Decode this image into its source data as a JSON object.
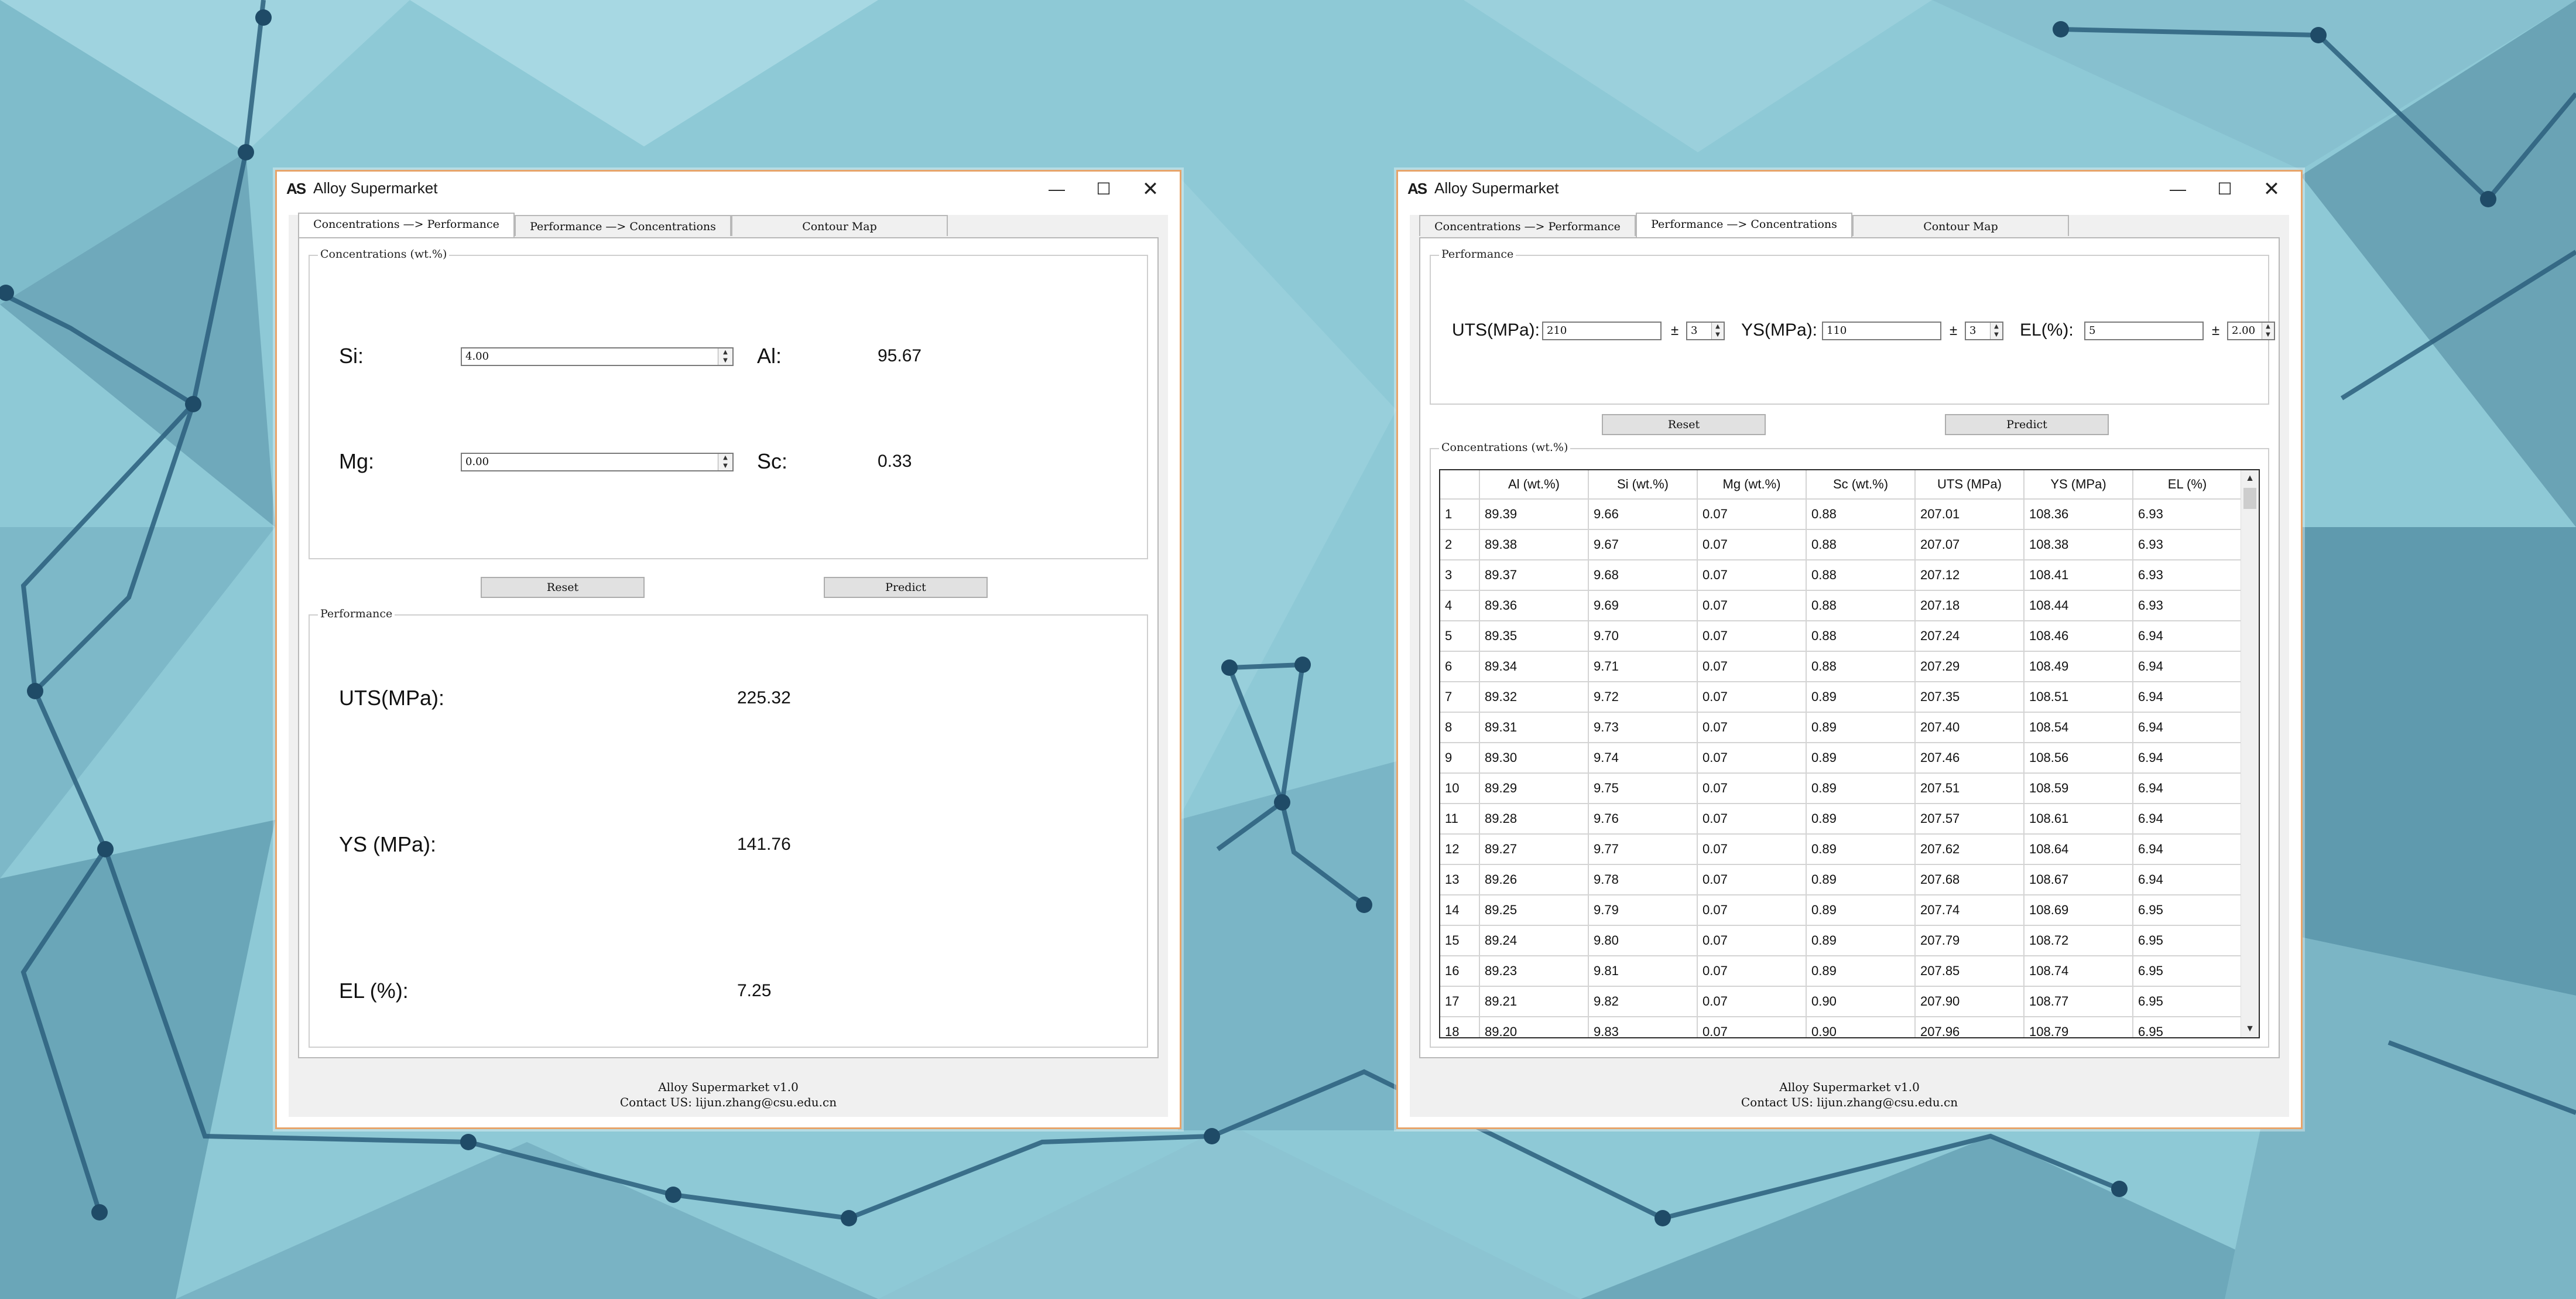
{
  "app": {
    "title": "Alloy Supermarket",
    "logo": "AS"
  },
  "window_controls": {
    "minimize": "—",
    "maximize": "☐",
    "close": "✕"
  },
  "tabs": [
    "Concentrations —> Performance",
    "Performance —> Concentrations",
    "Contour Map"
  ],
  "footer": {
    "line1": "Alloy Supermarket v1.0",
    "line2": "Contact US: lijun.zhang@csu.edu.cn"
  },
  "left_window": {
    "concentrations_group": "Concentrations (wt.%)",
    "si_label": "Si:",
    "si_value": "4.00",
    "al_label": "Al:",
    "al_value": "95.67",
    "mg_label": "Mg:",
    "mg_value": "0.00",
    "sc_label": "Sc:",
    "sc_value": "0.33",
    "reset": "Reset",
    "predict": "Predict",
    "performance_group": "Performance",
    "uts_label": "UTS(MPa):",
    "uts_value": "225.32",
    "ys_label": "YS (MPa):",
    "ys_value": "141.76",
    "el_label": "EL (%):",
    "el_value": "7.25"
  },
  "right_window": {
    "performance_group": "Performance",
    "uts_label": "UTS(MPa):",
    "uts_value": "210",
    "uts_tol": "3",
    "ys_label": "YS(MPa):",
    "ys_value": "110",
    "ys_tol": "3",
    "el_label": "EL(%):",
    "el_value": "5",
    "el_tol": "2.00",
    "pm": "±",
    "reset": "Reset",
    "predict": "Predict",
    "concentrations_group": "Concentrations (wt.%)",
    "columns": [
      "Al (wt.%)",
      "Si (wt.%)",
      "Mg (wt.%)",
      "Sc (wt.%)",
      "UTS (MPa)",
      "YS (MPa)",
      "EL (%)"
    ],
    "rows": [
      [
        "1",
        "89.39",
        "9.66",
        "0.07",
        "0.88",
        "207.01",
        "108.36",
        "6.93"
      ],
      [
        "2",
        "89.38",
        "9.67",
        "0.07",
        "0.88",
        "207.07",
        "108.38",
        "6.93"
      ],
      [
        "3",
        "89.37",
        "9.68",
        "0.07",
        "0.88",
        "207.12",
        "108.41",
        "6.93"
      ],
      [
        "4",
        "89.36",
        "9.69",
        "0.07",
        "0.88",
        "207.18",
        "108.44",
        "6.93"
      ],
      [
        "5",
        "89.35",
        "9.70",
        "0.07",
        "0.88",
        "207.24",
        "108.46",
        "6.94"
      ],
      [
        "6",
        "89.34",
        "9.71",
        "0.07",
        "0.88",
        "207.29",
        "108.49",
        "6.94"
      ],
      [
        "7",
        "89.32",
        "9.72",
        "0.07",
        "0.89",
        "207.35",
        "108.51",
        "6.94"
      ],
      [
        "8",
        "89.31",
        "9.73",
        "0.07",
        "0.89",
        "207.40",
        "108.54",
        "6.94"
      ],
      [
        "9",
        "89.30",
        "9.74",
        "0.07",
        "0.89",
        "207.46",
        "108.56",
        "6.94"
      ],
      [
        "10",
        "89.29",
        "9.75",
        "0.07",
        "0.89",
        "207.51",
        "108.59",
        "6.94"
      ],
      [
        "11",
        "89.28",
        "9.76",
        "0.07",
        "0.89",
        "207.57",
        "108.61",
        "6.94"
      ],
      [
        "12",
        "89.27",
        "9.77",
        "0.07",
        "0.89",
        "207.62",
        "108.64",
        "6.94"
      ],
      [
        "13",
        "89.26",
        "9.78",
        "0.07",
        "0.89",
        "207.68",
        "108.67",
        "6.94"
      ],
      [
        "14",
        "89.25",
        "9.79",
        "0.07",
        "0.89",
        "207.74",
        "108.69",
        "6.95"
      ],
      [
        "15",
        "89.24",
        "9.80",
        "0.07",
        "0.89",
        "207.79",
        "108.72",
        "6.95"
      ],
      [
        "16",
        "89.23",
        "9.81",
        "0.07",
        "0.89",
        "207.85",
        "108.74",
        "6.95"
      ],
      [
        "17",
        "89.21",
        "9.82",
        "0.07",
        "0.90",
        "207.90",
        "108.77",
        "6.95"
      ],
      [
        "18",
        "89.20",
        "9.83",
        "0.07",
        "0.90",
        "207.96",
        "108.79",
        "6.95"
      ]
    ]
  },
  "colors": {
    "window_border": "#e7a46a",
    "desktop_bg": "#8ec9d6"
  }
}
